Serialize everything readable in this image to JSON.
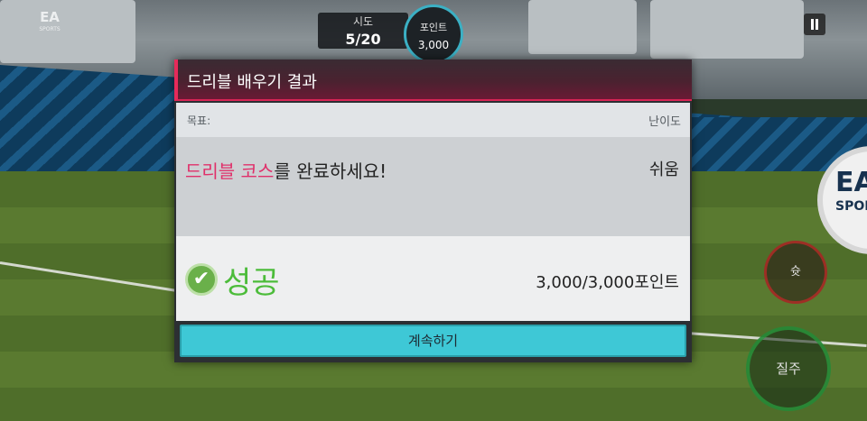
{
  "hud": {
    "attempts_label": "시도",
    "attempts_value": "5/20",
    "points_label": "포인트",
    "points_value": "3,000"
  },
  "brand": {
    "logo": "EA",
    "logo_sub": "SPORTS"
  },
  "modal": {
    "title": "드리블 배우기 결과",
    "goal_label": "목표:",
    "difficulty_label": "난이도",
    "task_highlight": "드리블 코스",
    "task_rest": "를 완료하세요!",
    "difficulty_value": "쉬움",
    "result_text": "성공",
    "points_result": "3,000/3,000포인트",
    "continue_label": "계속하기"
  },
  "controls": {
    "shoot_label": "슛",
    "sprint_label": "질주"
  },
  "colors": {
    "accent_pink": "#e0306a",
    "success_green": "#4cbc3a",
    "continue_cyan": "#3ec8d6"
  }
}
